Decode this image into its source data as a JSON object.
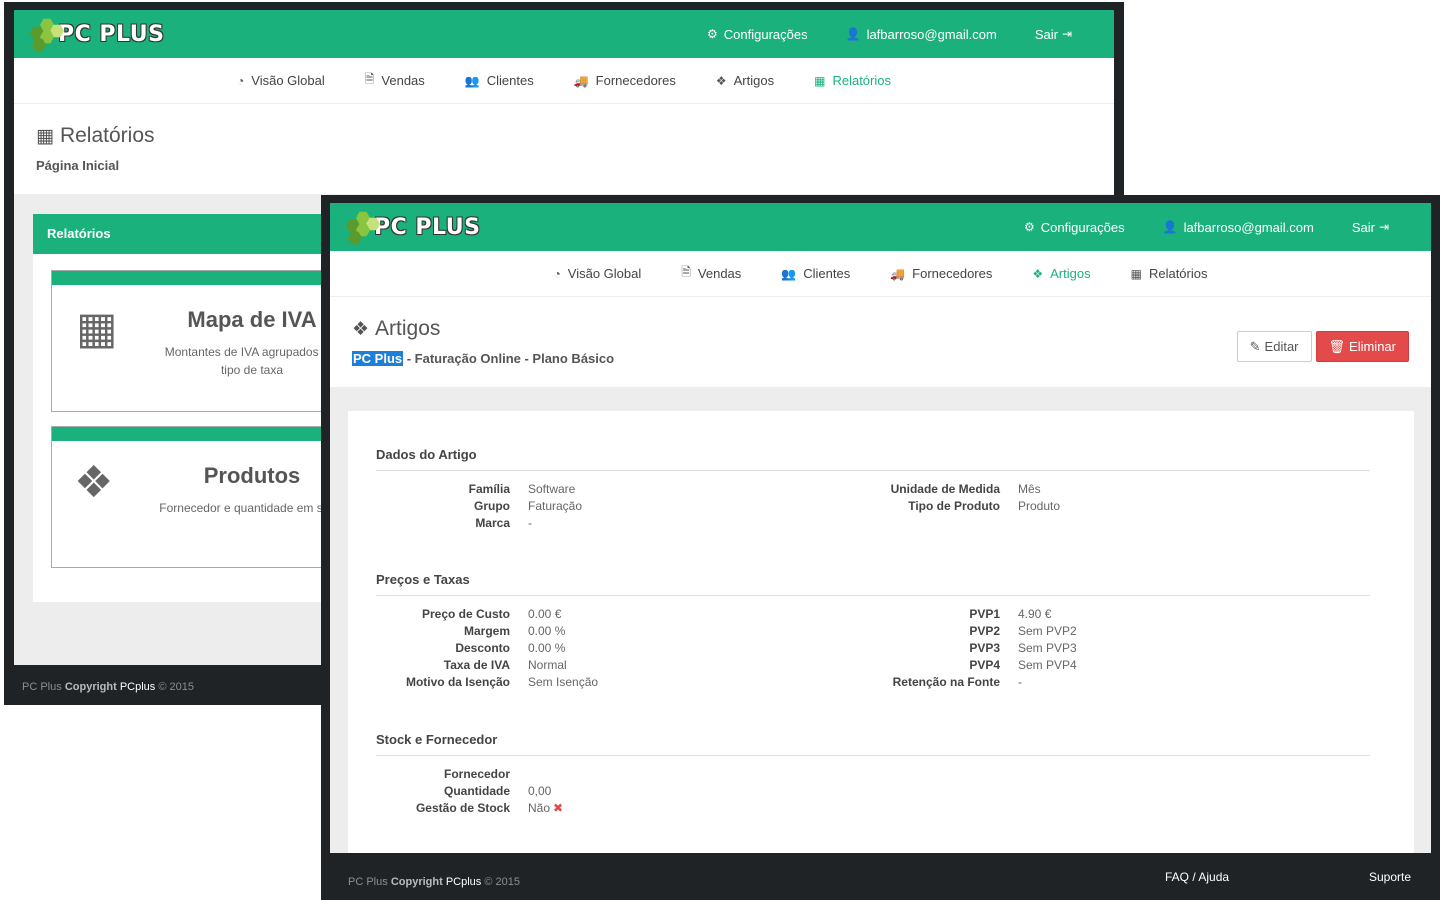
{
  "brand": {
    "name": "PC PLUS"
  },
  "back": {
    "top_nav": [
      {
        "icon": "cogs-icon",
        "glyph": "⚙",
        "label": "Configurações"
      },
      {
        "icon": "user-icon",
        "glyph": "👤",
        "label": "lafbarroso@gmail.com"
      },
      {
        "icon": "sign-out-icon",
        "glyph": "⇥",
        "label": "Sair"
      }
    ],
    "main_nav": [
      {
        "icon": "dashboard-icon",
        "glyph": "◔",
        "label": "Visão Global"
      },
      {
        "icon": "file-icon",
        "glyph": "🗎",
        "label": "Vendas"
      },
      {
        "icon": "users-icon",
        "glyph": "👥",
        "label": "Clientes"
      },
      {
        "icon": "truck-icon",
        "glyph": "🚚",
        "label": "Fornecedores"
      },
      {
        "icon": "cubes-icon",
        "glyph": "❖",
        "label": "Artigos"
      },
      {
        "icon": "table-icon",
        "glyph": "▦",
        "label": "Relatórios",
        "active": true
      }
    ],
    "header": {
      "title": "Relatórios",
      "subtitle": "Página Inicial"
    },
    "panel": {
      "title": "Relatórios",
      "reports": [
        {
          "title": "Mapa de IVA",
          "description_line1": "Montantes de IVA agrupados por",
          "description_line2": "tipo de taxa"
        },
        {
          "title": "Produtos",
          "description_line1": "Fornecedor e quantidade em stock",
          "description_line2": ""
        }
      ]
    },
    "footer": {
      "brand": "PC Plus",
      "copyright": "Copyright",
      "company": "PCplus",
      "year": "© 2015"
    }
  },
  "front": {
    "top_nav": [
      {
        "icon": "cogs-icon",
        "glyph": "⚙",
        "label": "Configurações"
      },
      {
        "icon": "user-icon",
        "glyph": "👤",
        "label": "lafbarroso@gmail.com"
      },
      {
        "icon": "sign-out-icon",
        "glyph": "⇥",
        "label": "Sair"
      }
    ],
    "main_nav": [
      {
        "icon": "dashboard-icon",
        "glyph": "◔",
        "label": "Visão Global"
      },
      {
        "icon": "file-icon",
        "glyph": "🗎",
        "label": "Vendas"
      },
      {
        "icon": "users-icon",
        "glyph": "👥",
        "label": "Clientes"
      },
      {
        "icon": "truck-icon",
        "glyph": "🚚",
        "label": "Fornecedores"
      },
      {
        "icon": "cubes-icon",
        "glyph": "❖",
        "label": "Artigos",
        "active": true
      },
      {
        "icon": "table-icon",
        "glyph": "▦",
        "label": "Relatórios"
      }
    ],
    "header": {
      "title": "Artigos",
      "subtitle_highlight": "PC Plus",
      "subtitle_rest": " - Faturação Online - Plano Básico"
    },
    "actions": {
      "edit": "Editar",
      "delete": "Eliminar"
    },
    "sections": {
      "dados": {
        "title": "Dados do Artigo",
        "left": [
          {
            "k": "Família",
            "v": "Software"
          },
          {
            "k": "Grupo",
            "v": "Faturação"
          },
          {
            "k": "Marca",
            "v": "-"
          }
        ],
        "right": [
          {
            "k": "Unidade de Medida",
            "v": "Mês"
          },
          {
            "k": "Tipo de Produto",
            "v": "Produto"
          }
        ]
      },
      "precos": {
        "title": "Preços e Taxas",
        "left": [
          {
            "k": "Preço de Custo",
            "v": "0.00 €"
          },
          {
            "k": "Margem",
            "v": "0.00 %"
          },
          {
            "k": "Desconto",
            "v": "0.00 %"
          },
          {
            "k": "Taxa de IVA",
            "v": "Normal"
          },
          {
            "k": "Motivo da Isenção",
            "v": "Sem Isenção"
          }
        ],
        "right": [
          {
            "k": "PVP1",
            "v": "4.90 €"
          },
          {
            "k": "PVP2",
            "v": "Sem PVP2"
          },
          {
            "k": "PVP3",
            "v": "Sem PVP3"
          },
          {
            "k": "PVP4",
            "v": "Sem PVP4"
          },
          {
            "k": "Retenção na Fonte",
            "v": "-"
          }
        ]
      },
      "stock": {
        "title": "Stock e Fornecedor",
        "left": [
          {
            "k": "Fornecedor",
            "v": ""
          },
          {
            "k": "Quantidade",
            "v": "0,00"
          },
          {
            "k": "Gestão de Stock",
            "v": "Não"
          }
        ]
      }
    },
    "footer": {
      "brand": "PC Plus",
      "copyright": "Copyright",
      "company": "PCplus",
      "year": "© 2015",
      "faq": "FAQ / Ajuda",
      "support": "Suporte"
    }
  }
}
